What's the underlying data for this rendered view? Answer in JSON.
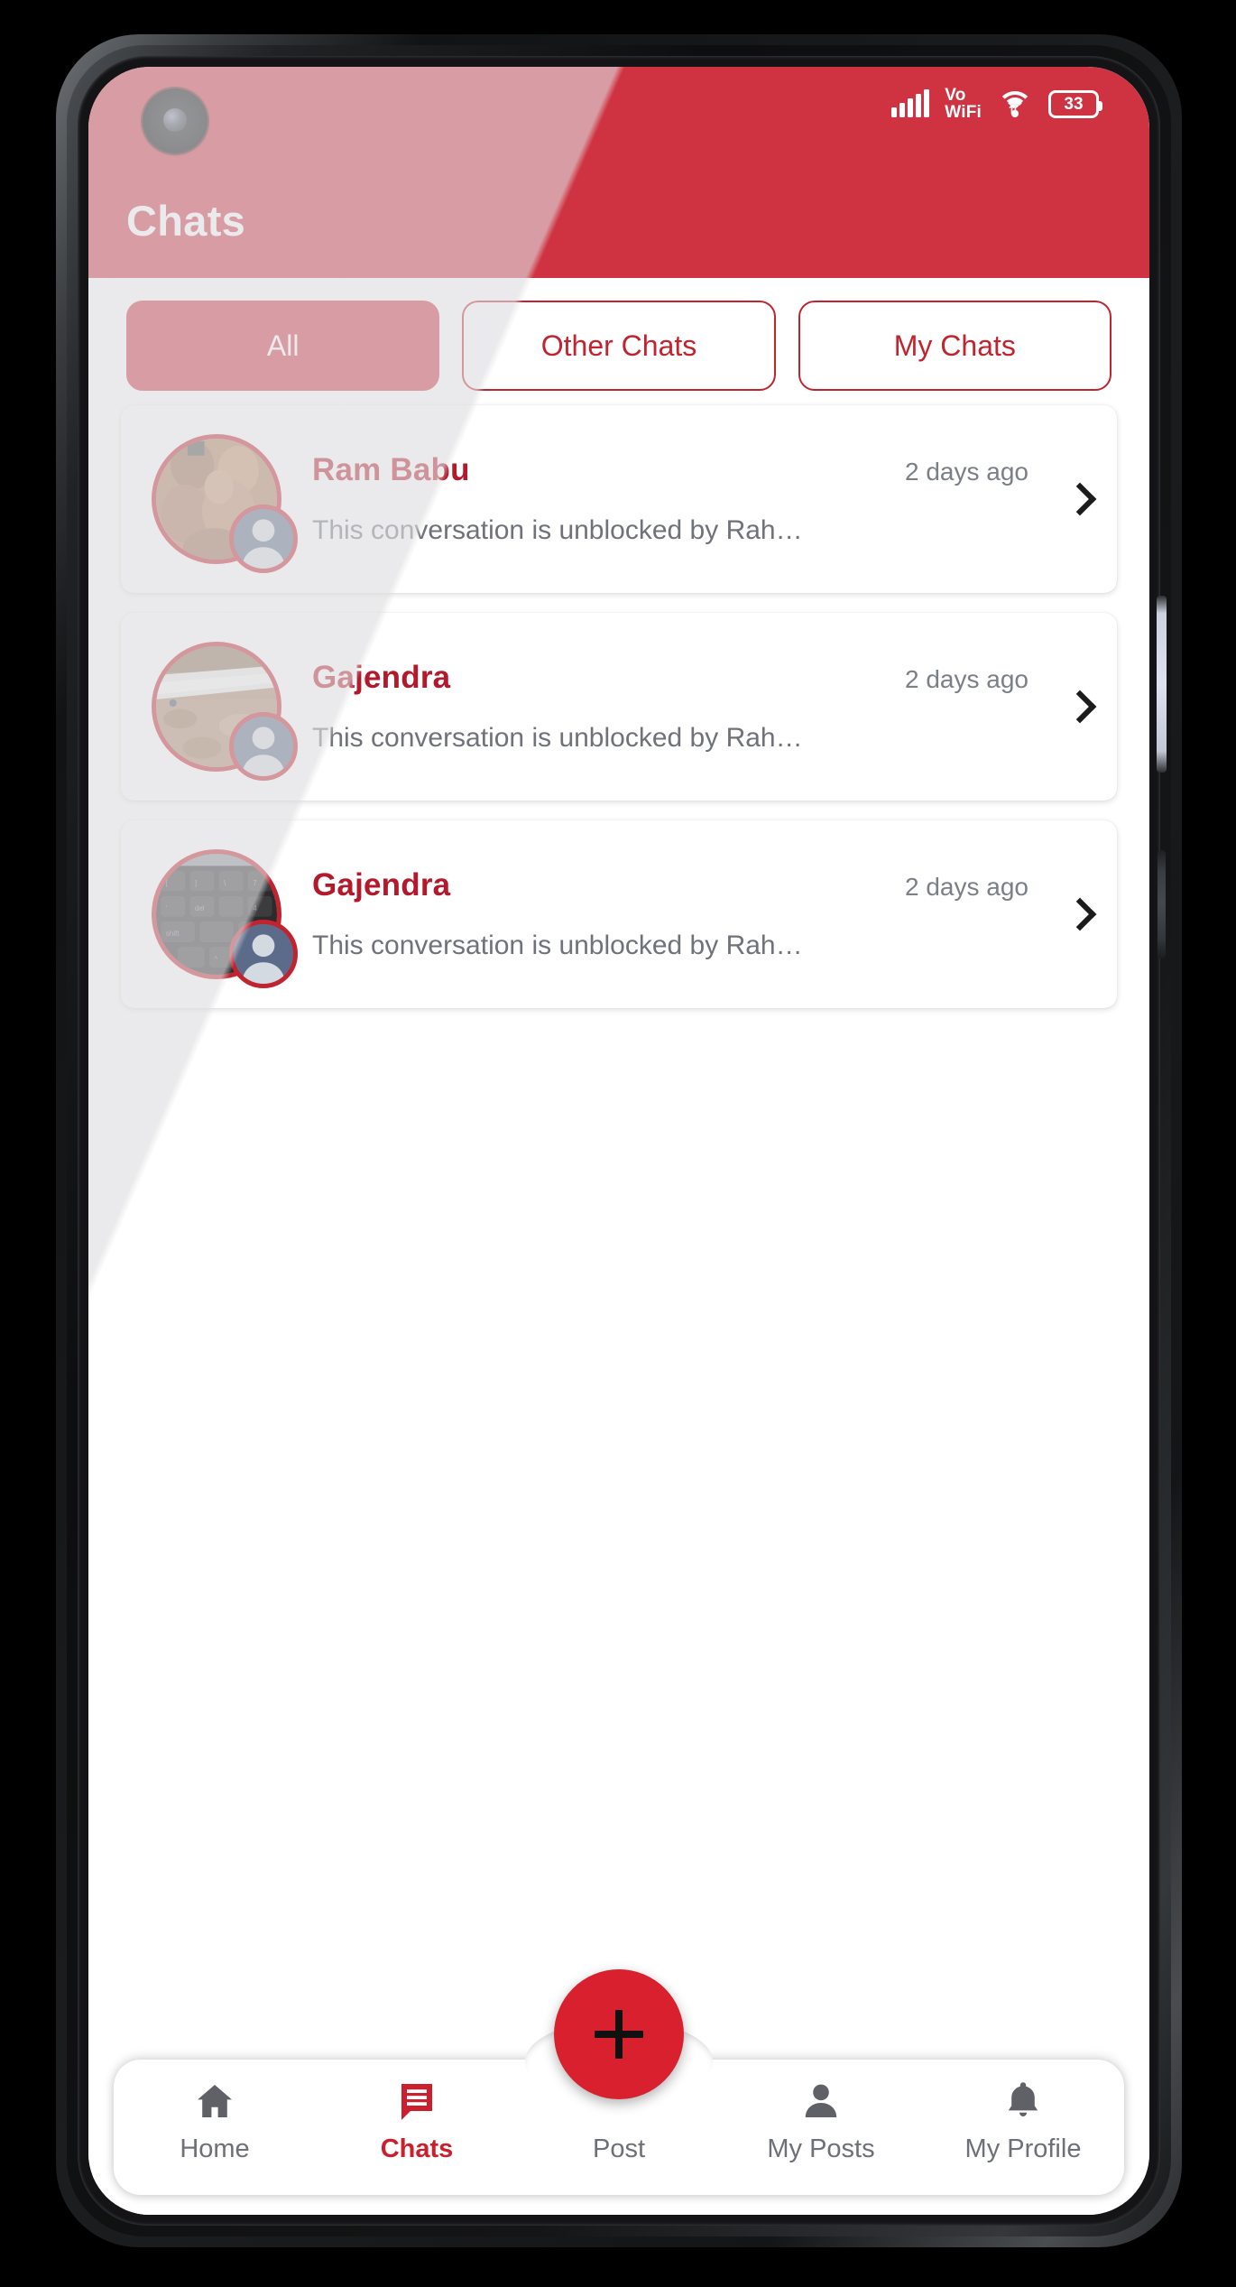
{
  "status_bar": {
    "signal_icon": "signal-bars-icon",
    "vo_label": "Vo",
    "wifi_label": "WiFi",
    "wifi_icon": "wifi-icon",
    "battery_level": "33",
    "battery_icon": "battery-icon"
  },
  "header": {
    "title": "Chats",
    "background_color": "#cf3341",
    "camera_icon": "front-camera-punch-hole"
  },
  "tabs": [
    {
      "label": "All",
      "active": true
    },
    {
      "label": "Other Chats",
      "active": false
    },
    {
      "label": "My Chats",
      "active": false
    }
  ],
  "chats": [
    {
      "name": "Ram Babu",
      "time": "2 days ago",
      "message": "This conversation is unblocked by Rah…",
      "avatar_kind": "statue-photo",
      "badge_icon": "user-avatar-icon",
      "chevron_icon": "chevron-right-icon"
    },
    {
      "name": "Gajendra",
      "time": "2 days ago",
      "message": "This conversation is unblocked by Rah…",
      "avatar_kind": "river-landscape-photo",
      "badge_icon": "user-avatar-icon",
      "chevron_icon": "chevron-right-icon"
    },
    {
      "name": "Gajendra",
      "time": "2 days ago",
      "message": "This conversation is unblocked by Rah…",
      "avatar_kind": "keyboard-photo",
      "badge_icon": "user-avatar-icon",
      "chevron_icon": "chevron-right-icon"
    }
  ],
  "fab": {
    "label": "+",
    "icon": "plus-icon",
    "color": "#d8202f"
  },
  "bottom_nav": [
    {
      "label": "Home",
      "icon": "home-icon",
      "active": false
    },
    {
      "label": "Chats",
      "icon": "chat-icon",
      "active": true
    },
    {
      "label": "Post",
      "icon": "plus-icon",
      "active": false
    },
    {
      "label": "My Posts",
      "icon": "person-icon",
      "active": false
    },
    {
      "label": "My Profile",
      "icon": "bell-icon",
      "active": false
    }
  ],
  "colors": {
    "brand_red": "#cf3341",
    "brand_red_dark": "#b3192a",
    "accent_red": "#c1232f",
    "muted_text": "#6f7278"
  }
}
